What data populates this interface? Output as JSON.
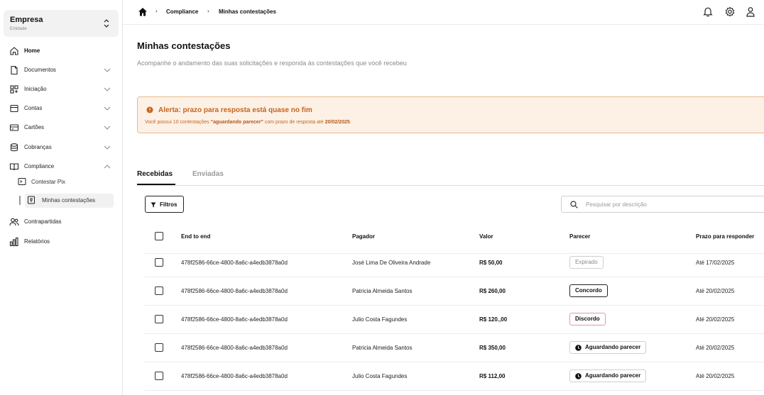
{
  "sidebar": {
    "company_name": "Empresa",
    "company_sub": "Entidade",
    "items": [
      {
        "label": "Home",
        "icon": "home-icon"
      },
      {
        "label": "Documentos",
        "icon": "document-icon"
      },
      {
        "label": "Iniciação",
        "icon": "grid-icon"
      },
      {
        "label": "Contas",
        "icon": "account-icon"
      },
      {
        "label": "Cartões",
        "icon": "card-icon"
      },
      {
        "label": "Cobranças",
        "icon": "coins-icon"
      },
      {
        "label": "Compliance",
        "icon": "book-icon"
      },
      {
        "label": "Contrapartidas",
        "icon": "users-icon"
      },
      {
        "label": "Relatórios",
        "icon": "chart-icon"
      }
    ],
    "sub_items": [
      {
        "label": "Contestar Pix",
        "icon": "terminal-icon"
      },
      {
        "label": "Minhas contestações",
        "icon": "file-icon"
      }
    ]
  },
  "breadcrumb": {
    "home_icon": "home-icon",
    "items": [
      "Compliance",
      "Minhas contestações"
    ]
  },
  "page": {
    "title": "Minhas contestações",
    "subtitle": "Acompanhe o andamento das suas solicitações e responda às contestações que você recebeu"
  },
  "alert": {
    "title": "Alerta: prazo para resposta está quase no fim",
    "text_before": "Você possui 10 contestações ",
    "text_highlight": "“aguardando parecer”",
    "text_middle": " com prazo de resposta até ",
    "text_date": "20/02/2025",
    "text_end": ".",
    "color": "#c4651d"
  },
  "tabs": [
    {
      "label": "Recebidas",
      "active": true
    },
    {
      "label": "Enviadas",
      "active": false
    }
  ],
  "filter_label": "Filtros",
  "search": {
    "placeholder": "Pesquisar por descrição"
  },
  "table": {
    "headers": [
      "End to end",
      "Pagador",
      "Valor",
      "Parecer",
      "Prazo para responder"
    ],
    "rows": [
      {
        "e2e": "478f2586-66ce-4800-8a6c-a4edb3878a0d",
        "pagador": "José Lima De Oliveira Andrade",
        "valor": "R$ 50,00",
        "parecer": "Expirado",
        "status": "expirado",
        "prazo": "Até 17/02/2025"
      },
      {
        "e2e": "478f2586-66ce-4800-8a6c-a4edb3878a0d",
        "pagador": "Patricia Almeida Santos",
        "valor": "R$ 260,00",
        "parecer": "Concordo",
        "status": "concordo",
        "prazo": "Até 20/02/2025"
      },
      {
        "e2e": "478f2586-66ce-4800-8a6c-a4edb3878a0d",
        "pagador": "Julio Costa Fagundes",
        "valor": "R$ 120.,00",
        "parecer": "Discordo",
        "status": "discordo",
        "prazo": "Até 20/02/2025"
      },
      {
        "e2e": "478f2586-66ce-4800-8a6c-a4edb3878a0d",
        "pagador": "Patricia Almeida Santos",
        "valor": "R$ 350,00",
        "parecer": "Aguardando parecer",
        "status": "aguardando",
        "prazo": "Até 20/02/2025"
      },
      {
        "e2e": "478f2586-66ce-4800-8a6c-a4edb3878a0d",
        "pagador": "Julio Costa Fagundes",
        "valor": "R$ 112,00",
        "parecer": "Aguardando parecer",
        "status": "aguardando",
        "prazo": "Até 20/02/2025"
      }
    ]
  }
}
